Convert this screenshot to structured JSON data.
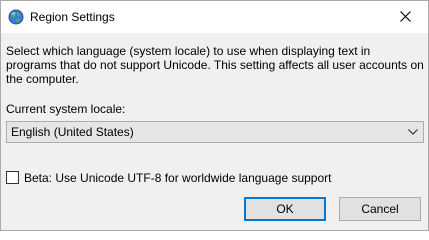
{
  "window": {
    "title": "Region Settings",
    "icon": "globe-settings-icon"
  },
  "dialog": {
    "description": "Select which language (system locale) to use when displaying text in programs that do not support Unicode. This setting affects all user accounts on the computer.",
    "locale_label": "Current system locale:",
    "locale_selected": "English (United States)",
    "beta_label": "Beta: Use Unicode UTF-8 for worldwide language support",
    "beta_checked": false
  },
  "buttons": {
    "ok": "OK",
    "cancel": "Cancel"
  },
  "colors": {
    "accent": "#0078d7",
    "dialog_bg": "#f0f0f0",
    "titlebar_bg": "#ffffff"
  }
}
